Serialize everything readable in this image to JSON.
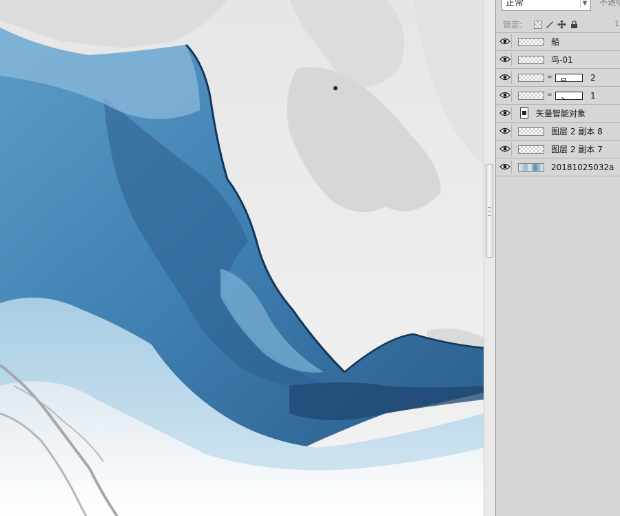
{
  "layers_panel": {
    "blend_mode": "正常",
    "opacity_label": "不透明",
    "lock_label": "锁定:",
    "lock_extra": "1",
    "layers": [
      {
        "name": "船",
        "kind": "pixel"
      },
      {
        "name": "鸟-01",
        "kind": "pixel"
      },
      {
        "name": "2",
        "kind": "masked"
      },
      {
        "name": "1",
        "kind": "masked"
      },
      {
        "name": "矢量智能对象",
        "kind": "smart"
      },
      {
        "name": "图层 2 副本 8",
        "kind": "pixel"
      },
      {
        "name": "图层 2 副本 7",
        "kind": "pixel"
      },
      {
        "name": "20181025032a",
        "kind": "photo"
      }
    ]
  },
  "icons": {
    "visibility": "eye-icon",
    "lock_transparent": "lock-transparent-icon",
    "lock_brush": "brush-icon",
    "lock_move": "move-icon",
    "lock_all": "lock-icon"
  },
  "colors": {
    "panel_bg": "#d6d6d6",
    "canvas_bg": "#efefef",
    "ink_dark": "#1e4a72",
    "ink_mid": "#4f8fbf",
    "ink_light": "#a9cfe6"
  }
}
